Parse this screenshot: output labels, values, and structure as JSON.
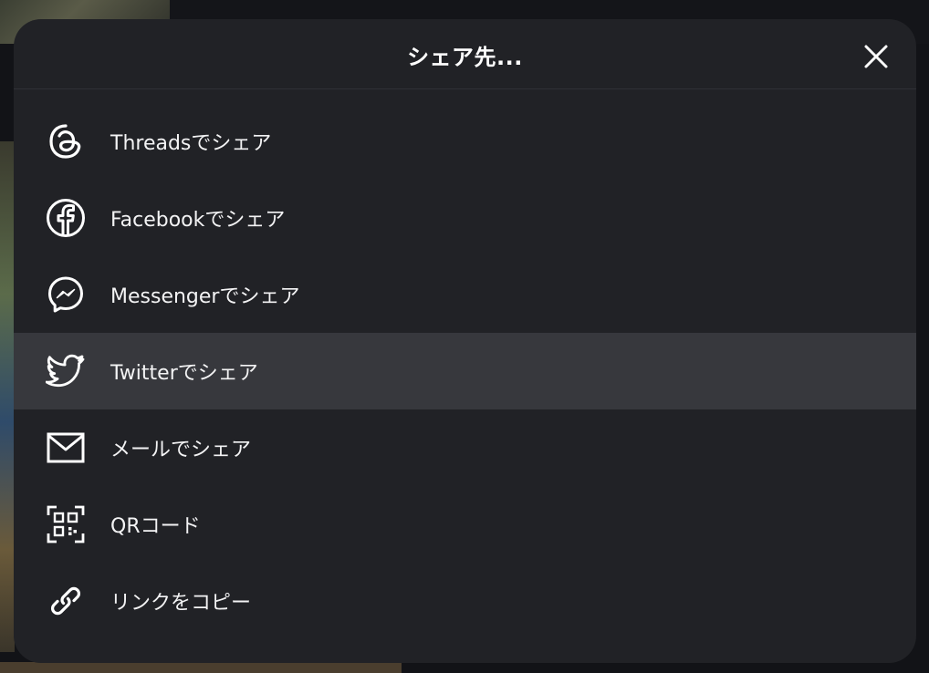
{
  "dialog": {
    "title": "シェア先...",
    "close_icon": "close-icon"
  },
  "menu": {
    "items": [
      {
        "label": "Threadsでシェア",
        "icon": "threads-icon",
        "highlighted": false
      },
      {
        "label": "Facebookでシェア",
        "icon": "facebook-icon",
        "highlighted": false
      },
      {
        "label": "Messengerでシェア",
        "icon": "messenger-icon",
        "highlighted": false
      },
      {
        "label": "Twitterでシェア",
        "icon": "twitter-icon",
        "highlighted": true
      },
      {
        "label": "メールでシェア",
        "icon": "mail-icon",
        "highlighted": false
      },
      {
        "label": "QRコード",
        "icon": "qr-code-icon",
        "highlighted": false
      },
      {
        "label": "リンクをコピー",
        "icon": "link-icon",
        "highlighted": false
      }
    ]
  },
  "colors": {
    "modal_background": "#212226",
    "hover_background": "#37383d",
    "text": "#f3f3f4"
  }
}
